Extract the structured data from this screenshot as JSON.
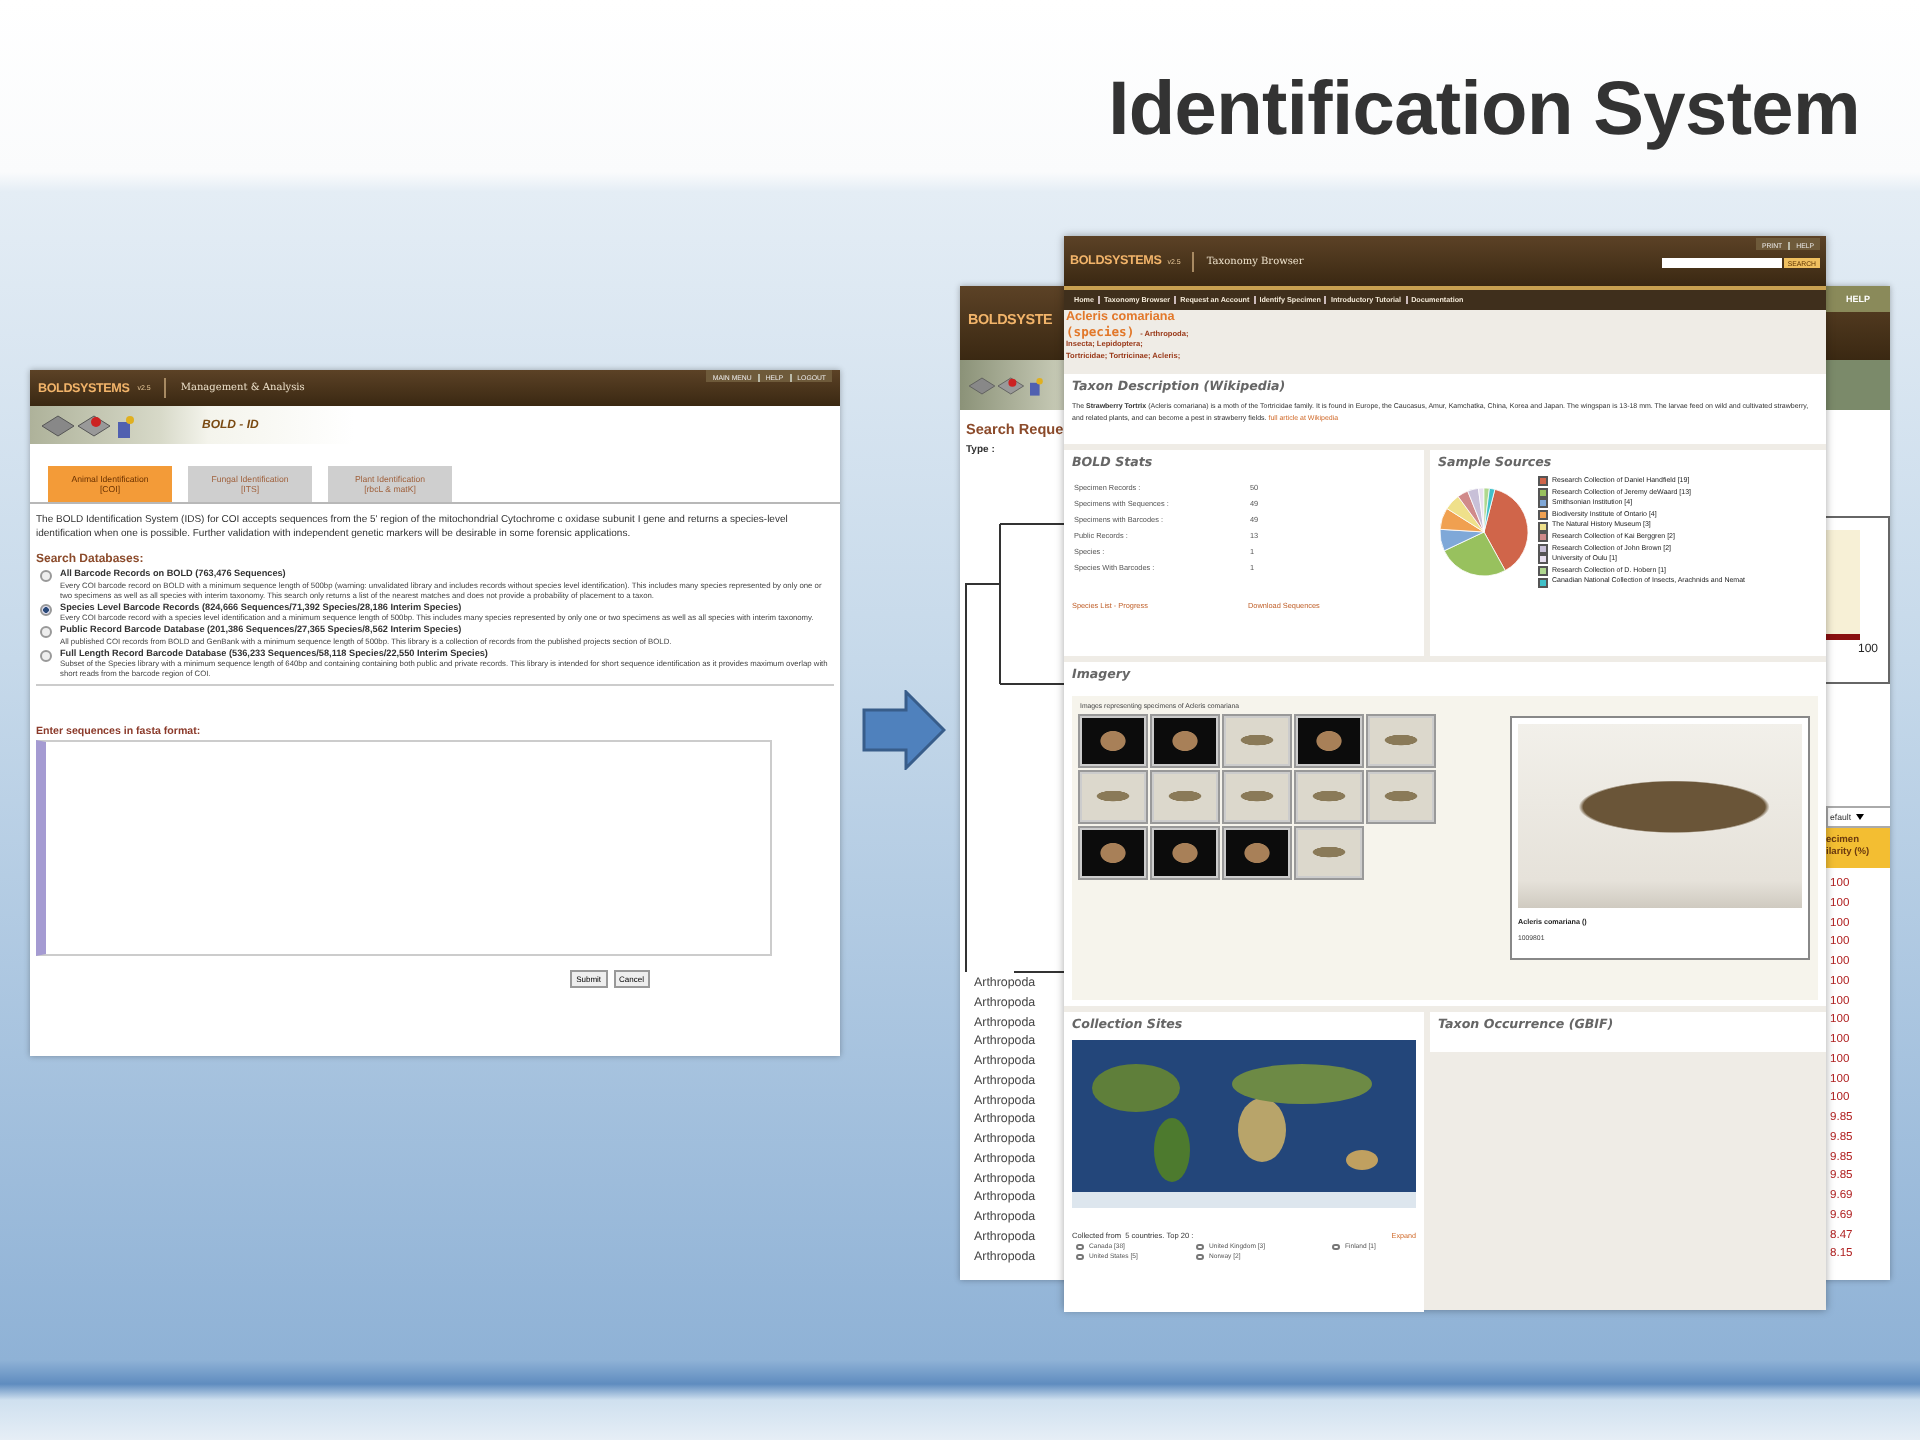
{
  "title": "Identification System",
  "left_window": {
    "brand": "BOLDSYSTEMS",
    "version": "v2.5",
    "section": "Management & Analysis",
    "top_links": [
      "MAIN MENU",
      "HELP",
      "LOGOUT"
    ],
    "page_title": "BOLD - ID",
    "tabs": [
      {
        "label": "Animal Identification",
        "sub": "[COI]",
        "selected": true
      },
      {
        "label": "Fungal Identification",
        "sub": "[ITS]",
        "selected": false
      },
      {
        "label": "Plant Identification",
        "sub": "[rbcL & matK]",
        "selected": false
      }
    ],
    "intro": "The BOLD Identification System (IDS) for COI accepts sequences from the 5' region of the mitochondrial Cytochrome c oxidase subunit I gene and returns a species-level identification when one is possible. Further validation with independent genetic markers will be desirable in some forensic applications.",
    "databases_heading": "Search Databases:",
    "databases": [
      {
        "title": "All Barcode Records on BOLD (763,476 Sequences)",
        "description": "Every COI barcode record on BOLD with a minimum sequence length of 500bp (warning: unvalidated library and includes records without species level identification). This includes many species represented by only one or two specimens as well as all species with interim taxonomy. This search only returns a list of the nearest matches and does not provide a probability of placement to a taxon.",
        "selected": false
      },
      {
        "title": "Species Level Barcode Records (824,666 Sequences/71,392 Species/28,186 Interim Species)",
        "description": "Every COI barcode record with a species level identification and a minimum sequence length of 500bp. This includes many species represented by only one or two specimens as well as all species with interim taxonomy.",
        "selected": true
      },
      {
        "title": "Public Record Barcode Database (201,386 Sequences/27,365 Species/8,562 Interim Species)",
        "description": "All published COI records from BOLD and GenBank with a minimum sequence length of 500bp. This library is a collection of records from the published projects section of BOLD.",
        "selected": false
      },
      {
        "title": "Full Length Record Barcode Database (536,233 Sequences/58,118 Species/22,550 Interim Species)",
        "description": "Subset of the Species library with a minimum sequence length of 640bp and containing containing both public and private records. This library is intended for short sequence identification as it provides maximum overlap with short reads from the barcode region of COI.",
        "selected": false
      }
    ],
    "sequence_label": "Enter sequences in fasta format:",
    "buttons": [
      "Submit",
      "Cancel"
    ]
  },
  "back_window": {
    "brand": "BOLDSYSTE",
    "top_link": "HELP",
    "heading": "Search Reque",
    "type_label": "Type :",
    "chart_label": "100",
    "sort_select": "efault",
    "column_header": [
      "ecimen",
      "ilarity (%)"
    ],
    "taxa": [
      "Arthropoda",
      "Arthropoda",
      "Arthropoda",
      "Arthropoda",
      "Arthropoda",
      "Arthropoda",
      "Arthropoda",
      "Arthropoda",
      "Arthropoda",
      "Arthropoda",
      "Arthropoda",
      "Arthropoda",
      "Arthropoda",
      "Arthropoda",
      "Arthropoda"
    ],
    "similarity": [
      "100",
      "100",
      "100",
      "100",
      "100",
      "100",
      "100",
      "100",
      "100",
      "100",
      "100",
      "100",
      "9.85",
      "9.85",
      "9.85",
      "9.85",
      "9.69",
      "9.69",
      "8.47",
      "8.15"
    ]
  },
  "front_window": {
    "brand": "BOLDSYSTEMS",
    "version": "v2.5",
    "section": "Taxonomy Browser",
    "top_links": [
      "PRINT",
      "HELP"
    ],
    "search_button": "SEARCH",
    "nav": [
      "Home",
      "Taxonomy Browser",
      "Request an Account",
      "Identify Specimen",
      "Introductory Tutorial",
      "Documentation"
    ],
    "taxon": {
      "name": "Acleris comariana",
      "rank": "(species)",
      "lineage": [
        "- Arthropoda;",
        "Insecta; Lepidoptera;",
        "Tortricidae; Tortricinae; Acleris;"
      ]
    },
    "description": {
      "title": "Taxon Description (Wikipedia)",
      "text": "The **Strawberry Tortrix** (Acleris comariana) is a moth of the Tortricidae family. It is found in Europe, the Caucasus, Amur, Kamchatka, China, Korea and Japan. The wingspan is 13-18 mm. The larvae feed on wild and cultivated strawberry, and related plants, and can become a pest in strawberry fields.",
      "link": "full article at Wikipedia"
    },
    "stats": {
      "title": "BOLD Stats",
      "rows": [
        {
          "label": "Specimen Records :",
          "value": "50"
        },
        {
          "label": "Specimens with Sequences :",
          "value": "49"
        },
        {
          "label": "Specimens with Barcodes :",
          "value": "49"
        },
        {
          "label": "Public Records :",
          "value": "13"
        },
        {
          "label": "Species :",
          "value": "1"
        },
        {
          "label": "Species With Barcodes :",
          "value": "1"
        }
      ],
      "links": [
        "Species List - Progress",
        "Download Sequences"
      ]
    },
    "sources": {
      "title": "Sample Sources",
      "items": [
        {
          "label": "Research Collection of Daniel Handfield [19]",
          "color": "#d0654a"
        },
        {
          "label": "Research Collection of Jeremy deWaard [13]",
          "color": "#98c15e"
        },
        {
          "label": "Smithsonian Institution [4]",
          "color": "#7fa8d8"
        },
        {
          "label": "Biodiversity Institute of Ontario [4]",
          "color": "#f0a050"
        },
        {
          "label": "The Natural History Museum [3]",
          "color": "#efe08a"
        },
        {
          "label": "Research Collection of Kai Berggren [2]",
          "color": "#d08a8a"
        },
        {
          "label": "Research Collection of John Brown [2]",
          "color": "#c8c0d8"
        },
        {
          "label": "University of Oulu [1]",
          "color": "#e8e0f0"
        },
        {
          "label": "Research Collection of D. Hobern [1]",
          "color": "#b0d890"
        },
        {
          "label": "Canadian National Collection of Insects, Arachnids and Nemat",
          "color": "#40c0c8"
        }
      ]
    },
    "imagery": {
      "title": "Imagery",
      "caption": "Images representing specimens of Acleris comariana",
      "thumbnails": [
        {
          "kind": "dark"
        },
        {
          "kind": "dark"
        },
        {
          "kind": "light"
        },
        {
          "kind": "dark"
        },
        {
          "kind": "light"
        },
        {
          "kind": "light"
        },
        {
          "kind": "light"
        },
        {
          "kind": "light"
        },
        {
          "kind": "light"
        },
        {
          "kind": "light"
        },
        {
          "kind": "dark"
        },
        {
          "kind": "dark"
        },
        {
          "kind": "dark"
        },
        {
          "kind": "light"
        }
      ],
      "specimen_name": "Acleris comariana ()",
      "specimen_id": "1009801"
    },
    "collection": {
      "title": "Collection Sites",
      "summary": "Collected from  5 countries. Top 20 :",
      "expand": "Expand",
      "countries": [
        "Canada [38]",
        "United Kingdom [3]",
        "Finland [1]",
        "United States [5]",
        "Norway [2]"
      ]
    },
    "occurrence": {
      "title": "Taxon Occurrence (GBIF)"
    }
  }
}
